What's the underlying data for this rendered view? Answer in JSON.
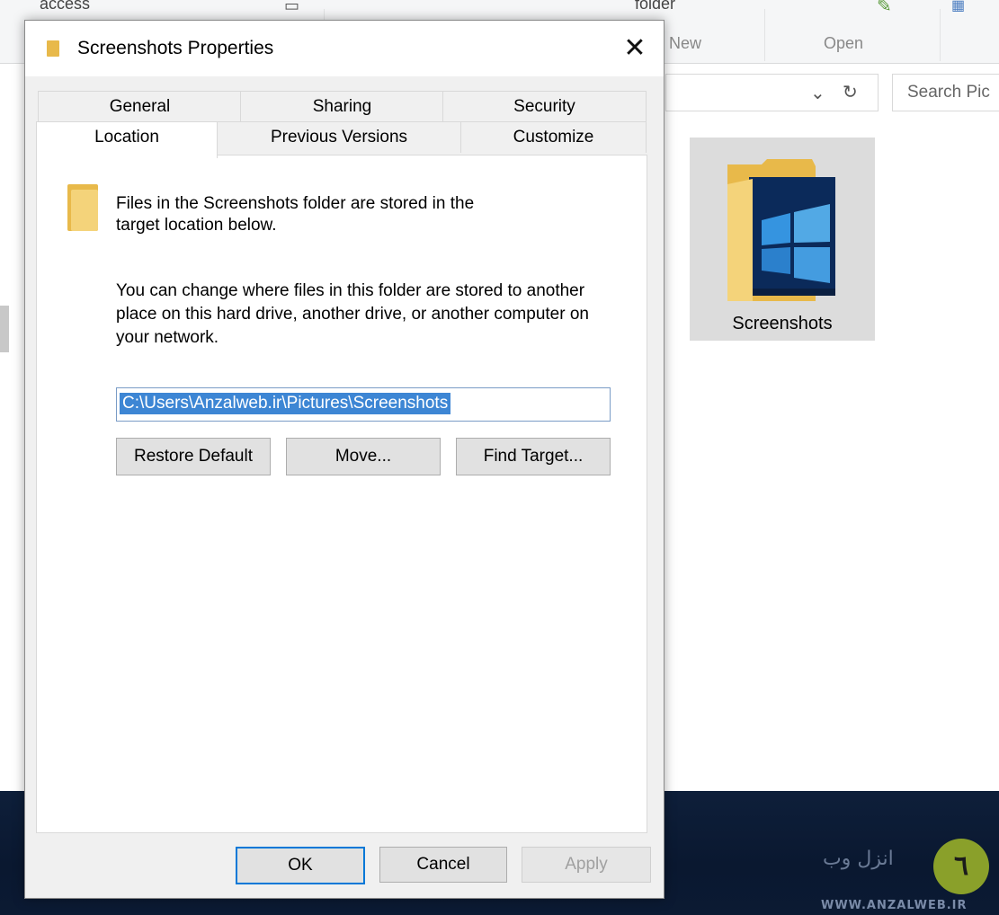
{
  "explorer": {
    "ribbon": {
      "partial_left_label": "access",
      "partial_folder_label": "folder",
      "new_label": "New",
      "open_label": "Open"
    },
    "search_placeholder": "Search Pic",
    "folder_tile_label": "Screenshots"
  },
  "watermark": {
    "site": "WWW.ANZALWEB.IR"
  },
  "dialog": {
    "title": "Screenshots Properties",
    "close_glyph": "✕",
    "tabs_back": [
      "General",
      "Sharing",
      "Security"
    ],
    "tabs_front": [
      "Location",
      "Previous Versions",
      "Customize"
    ],
    "active_tab": "Location",
    "description_1": "Files in the Screenshots folder are stored in the target location below.",
    "description_2": "You can change where files in this folder are stored to another place on this hard drive, another drive, or another computer on your network.",
    "path_value": "C:\\Users\\Anzalweb.ir\\Pictures\\Screenshots",
    "buttons": {
      "restore_default": "Restore Default",
      "move": "Move...",
      "find_target": "Find Target...",
      "ok": "OK",
      "cancel": "Cancel",
      "apply": "Apply"
    }
  },
  "colors": {
    "accent": "#0078d7",
    "selection": "#3d86d4",
    "folder": "#e8b94a"
  }
}
